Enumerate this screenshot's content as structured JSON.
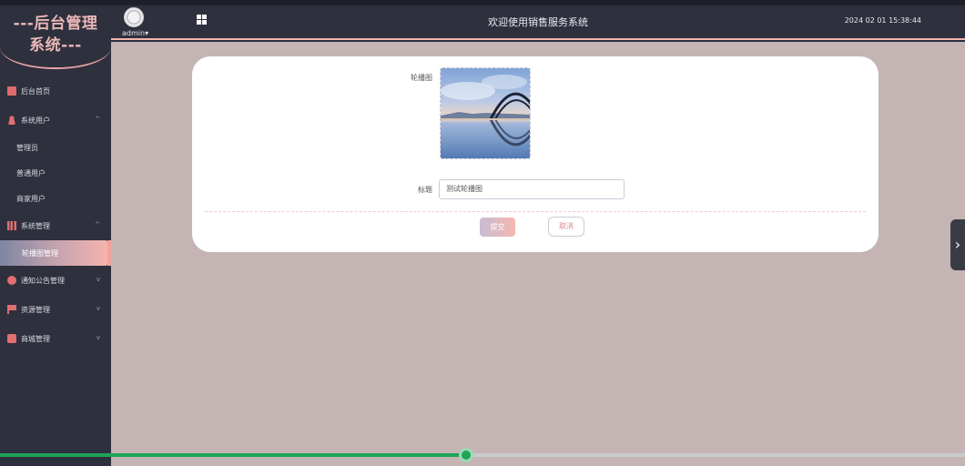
{
  "app": {
    "logo_line1": "---后台管理",
    "logo_line2": "系统---",
    "header_title": "欢迎使用销售服务系统",
    "header_time": "2024 02 01 15:38:44",
    "user_name": "admin",
    "user_caret": "▾"
  },
  "sidebar": {
    "items": [
      {
        "label": "后台首页",
        "icon": "monitor-icon"
      },
      {
        "label": "系统用户",
        "icon": "user-icon",
        "arrow": "^",
        "children": [
          "管理员",
          "普通用户",
          "商家用户"
        ]
      },
      {
        "label": "系统管理",
        "icon": "bar-chart-icon",
        "arrow": "^",
        "children": [
          "轮播图管理"
        ]
      },
      {
        "label": "通知公告管理",
        "icon": "info-icon",
        "arrow": "v"
      },
      {
        "label": "资源管理",
        "icon": "flag-icon",
        "arrow": "v"
      },
      {
        "label": "商城管理",
        "icon": "bag-icon",
        "arrow": "v"
      }
    ]
  },
  "form": {
    "image_label": "轮播图",
    "title_label": "标题",
    "title_value": "测试轮播图",
    "submit_label": "提交",
    "cancel_label": "取消"
  },
  "side_tab_glyph": "›",
  "video": {
    "progress": 0.483
  },
  "colors": {
    "sidebar_bg": "#2e303d",
    "accent_pink": "#f0b3b0",
    "main_bg": "#c4b5b4",
    "progress_green": "#1fa458"
  }
}
